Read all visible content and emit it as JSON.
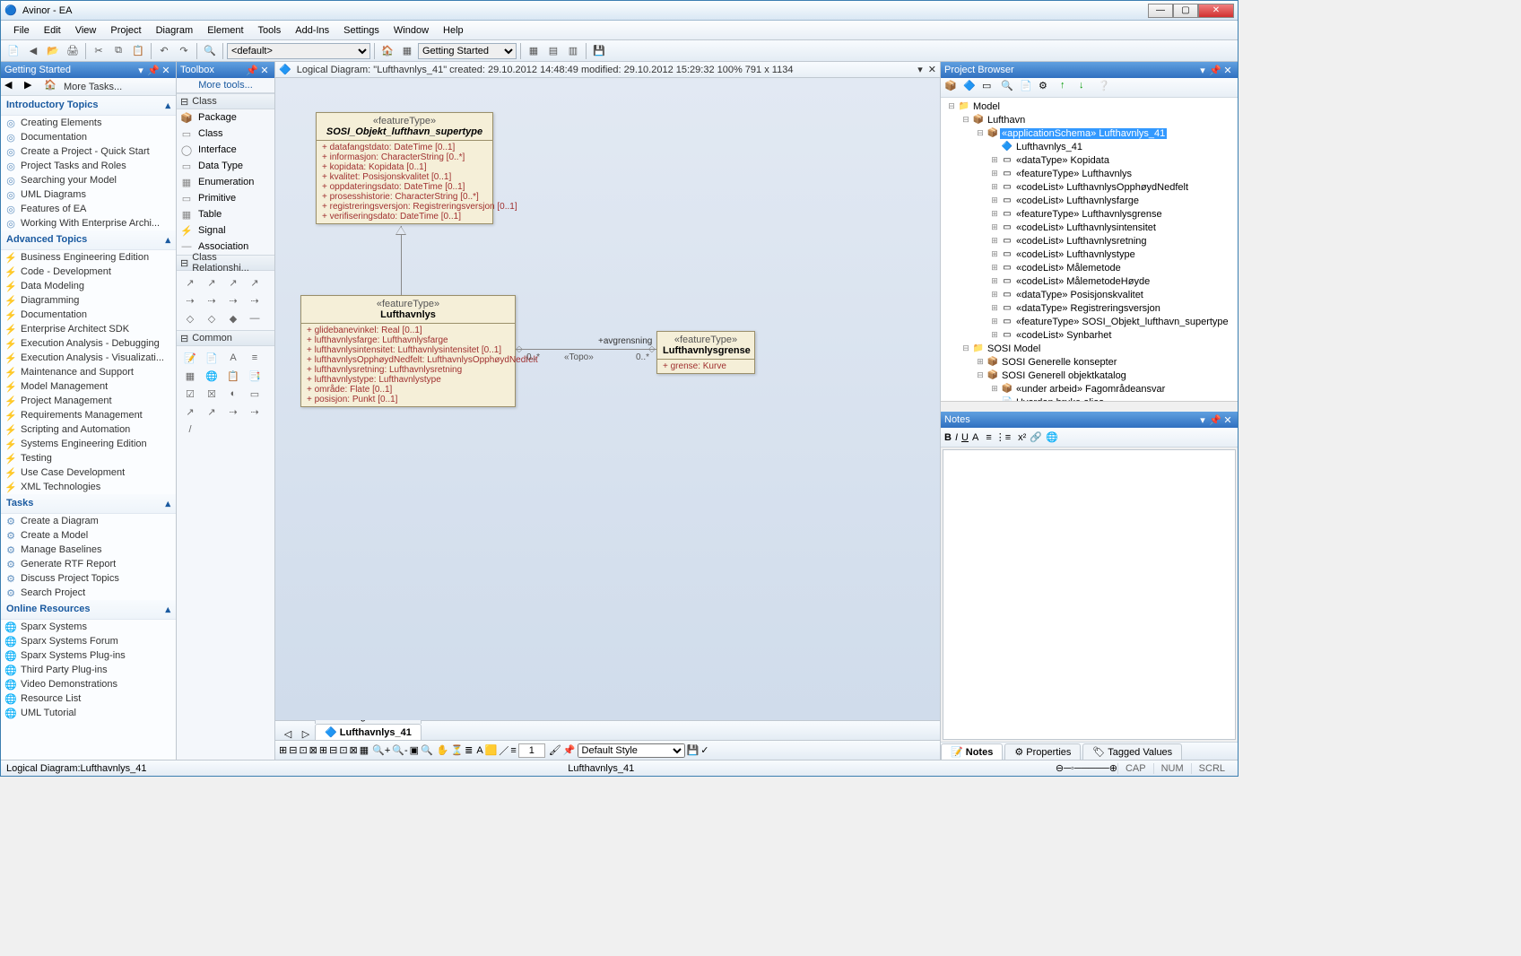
{
  "window": {
    "title": "Avinor - EA"
  },
  "menus": [
    "File",
    "Edit",
    "View",
    "Project",
    "Diagram",
    "Element",
    "Tools",
    "Add-Ins",
    "Settings",
    "Window",
    "Help"
  ],
  "toolbar_main": {
    "default_combo": "<default>",
    "getting_started_combo": "Getting Started"
  },
  "getting_started": {
    "title": "Getting Started",
    "more_tasks": "More Tasks...",
    "sections": [
      {
        "title": "Introductory Topics",
        "items": [
          "Creating Elements",
          "Documentation",
          "Create a Project - Quick Start",
          "Project Tasks and Roles",
          "Searching your Model",
          "UML Diagrams",
          "Features of EA",
          "Working With Enterprise Archi..."
        ]
      },
      {
        "title": "Advanced Topics",
        "items": [
          "Business Engineering Edition",
          "Code - Development",
          "Data Modeling",
          "Diagramming",
          "Documentation",
          "Enterprise Architect SDK",
          "Execution Analysis - Debugging",
          "Execution Analysis - Visualizati...",
          "Maintenance and Support",
          "Model Management",
          "Project Management",
          "Requirements Management",
          "Scripting and Automation",
          "Systems Engineering Edition",
          "Testing",
          "Use Case Development",
          "XML Technologies"
        ]
      },
      {
        "title": "Tasks",
        "items": [
          "Create a Diagram",
          "Create a Model",
          "Manage Baselines",
          "Generate RTF Report",
          "Discuss Project Topics",
          "Search Project"
        ]
      },
      {
        "title": "Online Resources",
        "items": [
          "Sparx Systems",
          "Sparx Systems Forum",
          "Sparx Systems Plug-ins",
          "Third Party Plug-ins",
          "Video Demonstrations",
          "Resource List",
          "UML Tutorial"
        ]
      }
    ]
  },
  "toolbox": {
    "title": "Toolbox",
    "more_tools": "More tools...",
    "class_header": "Class",
    "class_items": [
      "Package",
      "Class",
      "Interface",
      "Data Type",
      "Enumeration",
      "Primitive",
      "Table",
      "Signal",
      "Association"
    ],
    "rel_header": "Class Relationshi...",
    "common_header": "Common"
  },
  "diagram": {
    "header_text": "Logical Diagram: \"Lufthavnlys_41\"   created: 29.10.2012 14:48:49  modified: 29.10.2012 15:29:32   100%   791 x 1134",
    "class1": {
      "stereo": "«featureType»",
      "name": "SOSI_Objekt_lufthavn_supertype",
      "attrs": [
        "+   datafangstdato:  DateTime [0..1]",
        "+   informasjon:  CharacterString [0..*]",
        "+   kopidata:  Kopidata [0..1]",
        "+   kvalitet:  Posisjonskvalitet [0..1]",
        "+   oppdateringsdato:  DateTime [0..1]",
        "+   prosesshistorie:  CharacterString [0..*]",
        "+   registreringsversjon:  Registreringsversjon [0..1]",
        "+   verifiseringsdato:  DateTime [0..1]"
      ]
    },
    "class2": {
      "stereo": "«featureType»",
      "name": "Lufthavnlys",
      "attrs": [
        "+   glidebanevinkel:  Real [0..1]",
        "+   lufthavnlysfarge:  Lufthavnlysfarge",
        "+   lufthavnlysintensitet:  Lufthavnlysintensitet [0..1]",
        "+   lufthavnlysOpphøydNedfelt:  LufthavnlysOpphøydNedfelt",
        "+   lufthavnlysretning:  Lufthavnlysretning",
        "+   lufthavnlystype:  Lufthavnlystype",
        "+   område:  Flate [0..1]",
        "+   posisjon:  Punkt [0..1]"
      ]
    },
    "class3": {
      "stereo": "«featureType»",
      "name": "Lufthavnlysgrense",
      "attrs": [
        "+   grense:  Kurve"
      ]
    },
    "assoc_label": "+avgrensning",
    "assoc_stereo": "«Topo»",
    "mult_left": "0..*",
    "mult_right": "0..*"
  },
  "tabs": [
    {
      "label": "Start Page",
      "icon": ""
    },
    {
      "label": "Lufthavnlys_41",
      "icon": "🔷",
      "active": true
    }
  ],
  "project_browser": {
    "title": "Project Browser",
    "tree": [
      {
        "d": 0,
        "tw": "⊟",
        "ic": "📁",
        "lbl": "Model"
      },
      {
        "d": 1,
        "tw": "⊟",
        "ic": "📦",
        "lbl": "Lufthavn"
      },
      {
        "d": 2,
        "tw": "⊟",
        "ic": "📦",
        "lbl": "«applicationSchema» Lufthavnlys_41",
        "sel": true
      },
      {
        "d": 3,
        "tw": "",
        "ic": "🔷",
        "lbl": "Lufthavnlys_41"
      },
      {
        "d": 3,
        "tw": "⊞",
        "ic": "▭",
        "lbl": "«dataType» Kopidata"
      },
      {
        "d": 3,
        "tw": "⊞",
        "ic": "▭",
        "lbl": "«featureType» Lufthavnlys"
      },
      {
        "d": 3,
        "tw": "⊞",
        "ic": "▭",
        "lbl": "«codeList» LufthavnlysOpphøydNedfelt"
      },
      {
        "d": 3,
        "tw": "⊞",
        "ic": "▭",
        "lbl": "«codeList» Lufthavnlysfarge"
      },
      {
        "d": 3,
        "tw": "⊞",
        "ic": "▭",
        "lbl": "«featureType» Lufthavnlysgrense"
      },
      {
        "d": 3,
        "tw": "⊞",
        "ic": "▭",
        "lbl": "«codeList» Lufthavnlysintensitet"
      },
      {
        "d": 3,
        "tw": "⊞",
        "ic": "▭",
        "lbl": "«codeList» Lufthavnlysretning"
      },
      {
        "d": 3,
        "tw": "⊞",
        "ic": "▭",
        "lbl": "«codeList» Lufthavnlystype"
      },
      {
        "d": 3,
        "tw": "⊞",
        "ic": "▭",
        "lbl": "«codeList» Målemetode"
      },
      {
        "d": 3,
        "tw": "⊞",
        "ic": "▭",
        "lbl": "«codeList» MålemetodeHøyde"
      },
      {
        "d": 3,
        "tw": "⊞",
        "ic": "▭",
        "lbl": "«dataType» Posisjonskvalitet"
      },
      {
        "d": 3,
        "tw": "⊞",
        "ic": "▭",
        "lbl": "«dataType» Registreringsversjon"
      },
      {
        "d": 3,
        "tw": "⊞",
        "ic": "▭",
        "lbl": "«featureType» SOSI_Objekt_lufthavn_supertype"
      },
      {
        "d": 3,
        "tw": "⊞",
        "ic": "▭",
        "lbl": "«codeList» Synbarhet"
      },
      {
        "d": 1,
        "tw": "⊟",
        "ic": "📁",
        "lbl": "SOSI Model"
      },
      {
        "d": 2,
        "tw": "⊞",
        "ic": "📦",
        "lbl": "SOSI Generelle konsepter"
      },
      {
        "d": 2,
        "tw": "⊟",
        "ic": "📦",
        "lbl": "SOSI Generell objektkatalog"
      },
      {
        "d": 3,
        "tw": "⊞",
        "ic": "📦",
        "lbl": "«under arbeid» Fagområdeansvar"
      },
      {
        "d": 3,
        "tw": "",
        "ic": "📄",
        "lbl": "Hvordan bruke alias"
      }
    ]
  },
  "notes": {
    "title": "Notes",
    "tabs": [
      "Notes",
      "Properties",
      "Tagged Values"
    ]
  },
  "toolbar2": {
    "spinner": "1",
    "style": "Default Style"
  },
  "status": {
    "left": "Logical Diagram:Lufthavnlys_41",
    "center": "Lufthavnlys_41",
    "cap": "CAP",
    "num": "NUM",
    "scrl": "SCRL"
  }
}
